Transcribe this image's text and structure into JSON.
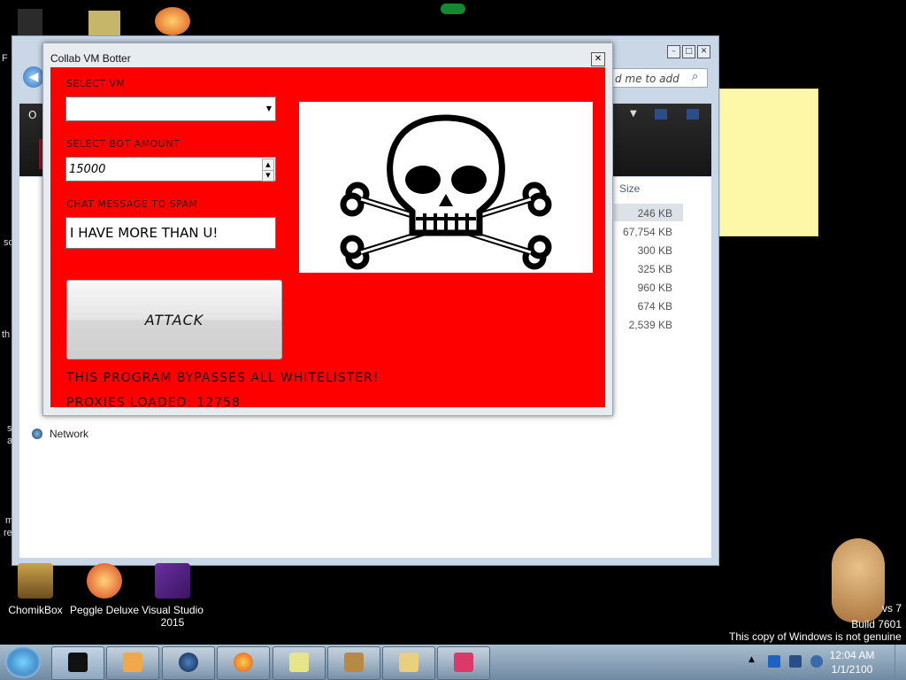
{
  "desktop": {
    "icons": [
      {
        "label": "ChomikBox"
      },
      {
        "label": "Peggle Deluxe"
      },
      {
        "label": "Visual Studio 2015"
      }
    ],
    "side_fragments": [
      "F",
      "sc",
      "th",
      "s",
      "a",
      "m",
      "re",
      "Network"
    ],
    "watermark": {
      "line1": "vs 7",
      "line2": "Build 7601",
      "line3": "This copy of Windows is not genuine"
    }
  },
  "explorer": {
    "search_placeholder": "d me to add",
    "column_size": "Size",
    "sizes": [
      "246 KB",
      "67,754 KB",
      "300 KB",
      "325 KB",
      "960 KB",
      "674 KB",
      "2,539 KB"
    ],
    "network_label": "Network",
    "side_label": "O"
  },
  "botter": {
    "title": "Collab VM Botter",
    "select_vm_label": "SELECT VM",
    "select_vm_value": "",
    "bot_amount_label": "SELECT BOT AMOUNT",
    "bot_amount_value": "15000",
    "chat_label": "CHAT MESSAGE TO SPAM",
    "chat_value": "I HAVE MORE THAN U!",
    "attack_label": "ATTACK",
    "bypass_text": "THIS PROGRAM BYPASSES ALL WHITELISTER!",
    "proxies_text": "PROXIES LOADED: 12758",
    "image_icon": "skull-and-crossbones-icon"
  },
  "taskbar": {
    "time": "12:04 AM",
    "date": "1/1/2100",
    "buttons": [
      "cmd-window",
      "media-player",
      "network-globe",
      "firefox",
      "sticky-notes",
      "chomikbox",
      "explorer",
      "paint"
    ]
  }
}
